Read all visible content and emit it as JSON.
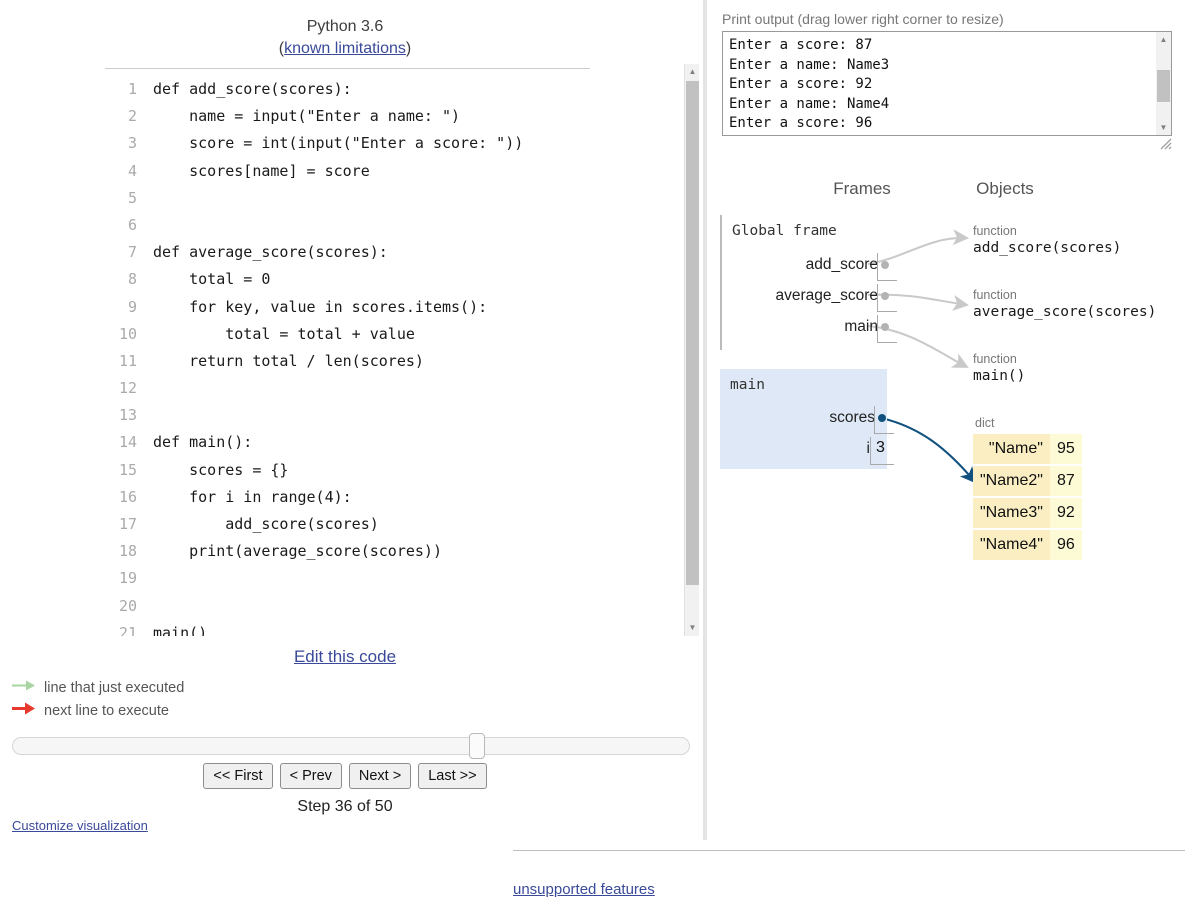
{
  "header": {
    "python_version": "Python 3.6",
    "limitations_prefix": "(",
    "limitations_link": "known limitations",
    "limitations_suffix": ")"
  },
  "code": {
    "lines": [
      {
        "num": "1",
        "text": "def add_score(scores):",
        "marker": "none"
      },
      {
        "num": "2",
        "text": "    name = input(\"Enter a name: \")",
        "marker": "none"
      },
      {
        "num": "3",
        "text": "    score = int(input(\"Enter a score: \"))",
        "marker": "none"
      },
      {
        "num": "4",
        "text": "    scores[name] = score",
        "marker": "none"
      },
      {
        "num": "5",
        "text": "",
        "marker": "none"
      },
      {
        "num": "6",
        "text": "",
        "marker": "none"
      },
      {
        "num": "7",
        "text": "def average_score(scores):",
        "marker": "none"
      },
      {
        "num": "8",
        "text": "    total = 0",
        "marker": "none"
      },
      {
        "num": "9",
        "text": "    for key, value in scores.items():",
        "marker": "none"
      },
      {
        "num": "10",
        "text": "        total = total + value",
        "marker": "none"
      },
      {
        "num": "11",
        "text": "    return total / len(scores)",
        "marker": "none"
      },
      {
        "num": "12",
        "text": "",
        "marker": "none"
      },
      {
        "num": "13",
        "text": "",
        "marker": "none"
      },
      {
        "num": "14",
        "text": "def main():",
        "marker": "none"
      },
      {
        "num": "15",
        "text": "    scores = {}",
        "marker": "none"
      },
      {
        "num": "16",
        "text": "    for i in range(4):",
        "marker": "green"
      },
      {
        "num": "17",
        "text": "        add_score(scores)",
        "marker": "none"
      },
      {
        "num": "18",
        "text": "    print(average_score(scores))",
        "marker": "red"
      },
      {
        "num": "19",
        "text": "",
        "marker": "none"
      },
      {
        "num": "20",
        "text": "",
        "marker": "none"
      },
      {
        "num": "21",
        "text": "main()",
        "marker": "none"
      }
    ],
    "edit_link": "Edit this code"
  },
  "legend": {
    "executed": "line that just executed",
    "next": "next line to execute",
    "executed_color": "#a8d5a2",
    "next_color": "#e8392f"
  },
  "controls": {
    "first": "<< First",
    "prev": "< Prev",
    "next": "Next >",
    "last": "Last >>",
    "step_label": "Step 36 of 50",
    "step_current": 36,
    "step_total": 50,
    "customize": "Customize visualization"
  },
  "stdout": {
    "label": "Print output (drag lower right corner to resize)",
    "lines": [
      "Enter a score: 87",
      "Enter a name: Name3",
      "Enter a score: 92",
      "Enter a name: Name4",
      "Enter a score: 96"
    ]
  },
  "viz": {
    "frames_header": "Frames",
    "objects_header": "Objects",
    "global_frame": {
      "title": "Global frame",
      "vars": [
        {
          "name": "add_score",
          "kind": "pointer"
        },
        {
          "name": "average_score",
          "kind": "pointer"
        },
        {
          "name": "main",
          "kind": "pointer"
        }
      ]
    },
    "main_frame": {
      "title": "main",
      "vars": [
        {
          "name": "scores",
          "kind": "pointer"
        },
        {
          "name": "i",
          "kind": "value",
          "value": "3"
        }
      ],
      "highlight_color": "#dfe8f6"
    },
    "objects": [
      {
        "type": "function",
        "name": "add_score(scores)"
      },
      {
        "type": "function",
        "name": "average_score(scores)"
      },
      {
        "type": "function",
        "name": "main()"
      }
    ],
    "dict_object": {
      "type": "dict",
      "entries": [
        {
          "key": "\"Name\"",
          "value": "95"
        },
        {
          "key": "\"Name2\"",
          "value": "87"
        },
        {
          "key": "\"Name3\"",
          "value": "92"
        },
        {
          "key": "\"Name4\"",
          "value": "96"
        }
      ],
      "key_color": "#faeec2",
      "value_color": "#fdfbd6"
    },
    "arrow_color_active": "#11517f",
    "arrow_color_inactive": "#c9c9c9"
  },
  "footer": {
    "unsupported": "unsupported features"
  }
}
